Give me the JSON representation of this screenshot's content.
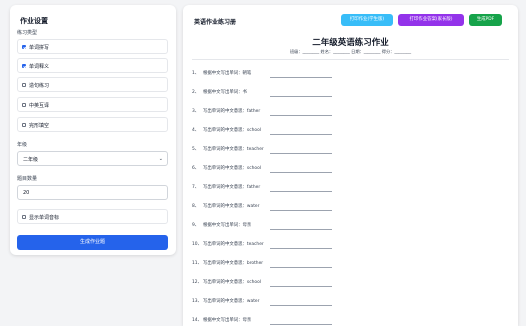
{
  "settings": {
    "title": "作业设置",
    "practice_type_label": "练习类型",
    "types": [
      {
        "label": "单词拼写",
        "checked": true
      },
      {
        "label": "单词释义",
        "checked": true
      },
      {
        "label": "造句练习",
        "checked": false
      },
      {
        "label": "中英互译",
        "checked": false
      },
      {
        "label": "完形填空",
        "checked": false
      }
    ],
    "grade_label": "年级",
    "grade_value": "二年级",
    "count_label": "题目数量",
    "count_value": "20",
    "phonetic_label": "显示单词音标",
    "phonetic_checked": false,
    "generate_label": "生成作业题"
  },
  "main": {
    "title": "英语作业练习册",
    "buttons": {
      "print_student": "打印作业(学生版)",
      "print_answer": "打印作业答案(家长版)",
      "pdf": "生成PDF"
    },
    "sheet_title": "二年级英语练习作业",
    "meta": "班级：________  姓名：________  日期：________  得分：________",
    "questions": [
      {
        "num": "1、",
        "text": "根据中文写出单词：朝笔"
      },
      {
        "num": "2、",
        "text": "根据中文写出单词：书"
      },
      {
        "num": "3、",
        "text": "写出单词的中文意思：father"
      },
      {
        "num": "4、",
        "text": "写出单词的中文意思：school"
      },
      {
        "num": "5、",
        "text": "写出单词的中文意思：teacher"
      },
      {
        "num": "6、",
        "text": "写出单词的中文意思：school"
      },
      {
        "num": "7、",
        "text": "写出单词的中文意思：father"
      },
      {
        "num": "8、",
        "text": "写出单词的中文意思：water"
      },
      {
        "num": "9、",
        "text": "根据中文写出单词：母亲"
      },
      {
        "num": "10、",
        "text": "写出单词的中文意思：teacher"
      },
      {
        "num": "11、",
        "text": "写出单词的中文意思：brother"
      },
      {
        "num": "12、",
        "text": "写出单词的中文意思：school"
      },
      {
        "num": "13、",
        "text": "写出单词的中文意思：water"
      },
      {
        "num": "14、",
        "text": "根据中文写出单词：母亲"
      }
    ]
  },
  "colors": {
    "print_student": "#38bdf8",
    "print_answer": "#9333ea",
    "pdf": "#16a34a",
    "primary": "#2563eb"
  }
}
